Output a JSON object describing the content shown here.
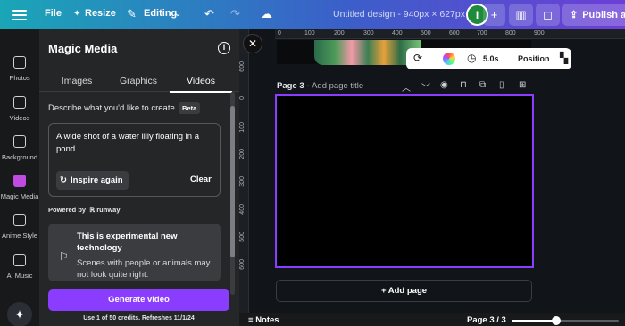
{
  "topbar": {
    "file_label": "File",
    "resize_label": "Resize",
    "editing_label": "Editing",
    "title": "Untitled design - 940px × 627px",
    "avatar_initial": "I",
    "publish_label": "Publish as"
  },
  "rail": {
    "items": [
      {
        "label": "Photos",
        "icon": "photo-icon"
      },
      {
        "label": "Videos",
        "icon": "video-icon"
      },
      {
        "label": "Background",
        "icon": "background-icon"
      },
      {
        "label": "Magic Media",
        "icon": "magic-media-icon"
      },
      {
        "label": "Anime Style",
        "icon": "anime-style-icon"
      },
      {
        "label": "AI Music",
        "icon": "music-icon"
      }
    ],
    "active": "Magic Media"
  },
  "panel": {
    "title": "Magic Media",
    "tabs": [
      "Images",
      "Graphics",
      "Videos"
    ],
    "active_tab": "Videos",
    "describe_label": "Describe what you'd like to create",
    "beta_badge": "Beta",
    "prompt_text": "A wide shot of a water lilly floating in a pond",
    "inspire_label": "Inspire again",
    "clear_label": "Clear",
    "powered_by": "Powered by",
    "powered_brand": "runway",
    "notice_title": "This is experimental new technology",
    "notice_body": "Scenes with people or animals may not look quite right.",
    "generate_label": "Generate video",
    "credits_text": "Use 1 of 50 credits. Refreshes 11/1/24"
  },
  "canvas": {
    "ruler_top_ticks": [
      "0",
      "100",
      "200",
      "300",
      "400",
      "500",
      "600",
      "700",
      "800",
      "900"
    ],
    "ruler_left_ticks": [
      "600",
      "0",
      "100",
      "200",
      "300",
      "400",
      "500",
      "600"
    ],
    "duration": "5.0s",
    "position_label": "Position",
    "page_label": "Page 3 - ",
    "page_title_placeholder": "Add page title",
    "add_page_label": "+ Add page",
    "notes_label": "Notes",
    "page_count": "Page 3 / 3",
    "zoom_fraction": 0.42
  },
  "colors": {
    "accent": "#8b3dff",
    "topbar_start": "#1aa6b7",
    "topbar_end": "#6d3fd6"
  }
}
